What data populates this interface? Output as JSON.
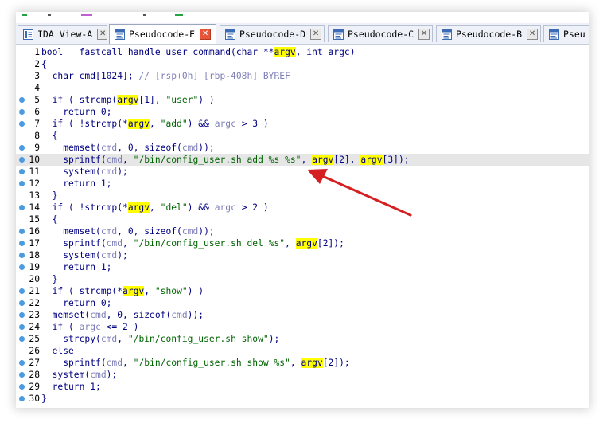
{
  "tabs": [
    {
      "label": "IDA View-A",
      "icon": "ida-view-icon",
      "active": false
    },
    {
      "label": "Pseudocode-E",
      "icon": "pseudocode-icon",
      "active": true
    },
    {
      "label": "Pseudocode-D",
      "icon": "pseudocode-icon",
      "active": false
    },
    {
      "label": "Pseudocode-C",
      "icon": "pseudocode-icon",
      "active": false
    },
    {
      "label": "Pseudocode-B",
      "icon": "pseudocode-icon",
      "active": false
    },
    {
      "label": "Pseu",
      "icon": "pseudocode-icon",
      "active": false
    }
  ],
  "colors": {
    "highlight": "#ffff00",
    "string": "#006400",
    "variable": "#7f7fb8",
    "keyword": "#000080",
    "breakpoint_dot": "#4a9be0",
    "arrow": "#d42020",
    "active_close": "#e8543a"
  },
  "code": {
    "current_line": 10,
    "highlighted_identifier": "argv",
    "lines": [
      {
        "n": "1",
        "dot": false,
        "segs": [
          [
            "t",
            "bool __fastcall handle_user_command(char **"
          ],
          [
            "h",
            "argv"
          ],
          [
            "t",
            ", int argc)"
          ]
        ]
      },
      {
        "n": "2",
        "dot": false,
        "segs": [
          [
            "t",
            "{"
          ]
        ]
      },
      {
        "n": "3",
        "dot": false,
        "segs": [
          [
            "t",
            "  char cmd[1024]; "
          ],
          [
            "c",
            "// [rsp+0h] [rbp-408h] BYREF"
          ]
        ]
      },
      {
        "n": "4",
        "dot": false,
        "segs": []
      },
      {
        "n": "5",
        "dot": true,
        "segs": [
          [
            "t",
            "  if ( strcmp("
          ],
          [
            "h",
            "argv"
          ],
          [
            "t",
            "[1], "
          ],
          [
            "s",
            "\"user\""
          ],
          [
            "t",
            ") )"
          ]
        ]
      },
      {
        "n": "6",
        "dot": true,
        "segs": [
          [
            "t",
            "    return 0;"
          ]
        ]
      },
      {
        "n": "7",
        "dot": true,
        "segs": [
          [
            "t",
            "  if ( !strcmp(*"
          ],
          [
            "h",
            "argv"
          ],
          [
            "t",
            ", "
          ],
          [
            "s",
            "\"add\""
          ],
          [
            "t",
            ") && "
          ],
          [
            "v",
            "argc"
          ],
          [
            "t",
            " > 3 )"
          ]
        ]
      },
      {
        "n": "8",
        "dot": false,
        "segs": [
          [
            "t",
            "  {"
          ]
        ]
      },
      {
        "n": "9",
        "dot": true,
        "segs": [
          [
            "t",
            "    memset("
          ],
          [
            "v",
            "cmd"
          ],
          [
            "t",
            ", 0, sizeof("
          ],
          [
            "v",
            "cmd"
          ],
          [
            "t",
            "));"
          ]
        ]
      },
      {
        "n": "10",
        "dot": true,
        "segs": [
          [
            "t",
            "    sprintf("
          ],
          [
            "v",
            "cmd"
          ],
          [
            "t",
            ", "
          ],
          [
            "s",
            "\"/bin/config_user.sh add %s %s\""
          ],
          [
            "t",
            ", "
          ],
          [
            "h",
            "argv"
          ],
          [
            "t",
            "[2], "
          ],
          [
            "h",
            "argv"
          ],
          [
            "t",
            "[3]);"
          ]
        ]
      },
      {
        "n": "11",
        "dot": true,
        "segs": [
          [
            "t",
            "    system("
          ],
          [
            "v",
            "cmd"
          ],
          [
            "t",
            ");"
          ]
        ]
      },
      {
        "n": "12",
        "dot": true,
        "segs": [
          [
            "t",
            "    return 1;"
          ]
        ]
      },
      {
        "n": "13",
        "dot": false,
        "segs": [
          [
            "t",
            "  }"
          ]
        ]
      },
      {
        "n": "14",
        "dot": true,
        "segs": [
          [
            "t",
            "  if ( !strcmp(*"
          ],
          [
            "h",
            "argv"
          ],
          [
            "t",
            ", "
          ],
          [
            "s",
            "\"del\""
          ],
          [
            "t",
            ") && "
          ],
          [
            "v",
            "argc"
          ],
          [
            "t",
            " > 2 )"
          ]
        ]
      },
      {
        "n": "15",
        "dot": false,
        "segs": [
          [
            "t",
            "  {"
          ]
        ]
      },
      {
        "n": "16",
        "dot": true,
        "segs": [
          [
            "t",
            "    memset("
          ],
          [
            "v",
            "cmd"
          ],
          [
            "t",
            ", 0, sizeof("
          ],
          [
            "v",
            "cmd"
          ],
          [
            "t",
            "));"
          ]
        ]
      },
      {
        "n": "17",
        "dot": true,
        "segs": [
          [
            "t",
            "    sprintf("
          ],
          [
            "v",
            "cmd"
          ],
          [
            "t",
            ", "
          ],
          [
            "s",
            "\"/bin/config_user.sh del %s\""
          ],
          [
            "t",
            ", "
          ],
          [
            "h",
            "argv"
          ],
          [
            "t",
            "[2]);"
          ]
        ]
      },
      {
        "n": "18",
        "dot": true,
        "segs": [
          [
            "t",
            "    system("
          ],
          [
            "v",
            "cmd"
          ],
          [
            "t",
            ");"
          ]
        ]
      },
      {
        "n": "19",
        "dot": true,
        "segs": [
          [
            "t",
            "    return 1;"
          ]
        ]
      },
      {
        "n": "20",
        "dot": false,
        "segs": [
          [
            "t",
            "  }"
          ]
        ]
      },
      {
        "n": "21",
        "dot": true,
        "segs": [
          [
            "t",
            "  if ( strcmp(*"
          ],
          [
            "h",
            "argv"
          ],
          [
            "t",
            ", "
          ],
          [
            "s",
            "\"show\""
          ],
          [
            "t",
            ") )"
          ]
        ]
      },
      {
        "n": "22",
        "dot": true,
        "segs": [
          [
            "t",
            "    return 0;"
          ]
        ]
      },
      {
        "n": "23",
        "dot": true,
        "segs": [
          [
            "t",
            "  memset("
          ],
          [
            "v",
            "cmd"
          ],
          [
            "t",
            ", 0, sizeof("
          ],
          [
            "v",
            "cmd"
          ],
          [
            "t",
            "));"
          ]
        ]
      },
      {
        "n": "24",
        "dot": true,
        "segs": [
          [
            "t",
            "  if ( "
          ],
          [
            "v",
            "argc"
          ],
          [
            "t",
            " <= 2 )"
          ]
        ]
      },
      {
        "n": "25",
        "dot": true,
        "segs": [
          [
            "t",
            "    strcpy("
          ],
          [
            "v",
            "cmd"
          ],
          [
            "t",
            ", "
          ],
          [
            "s",
            "\"/bin/config_user.sh show\""
          ],
          [
            "t",
            ");"
          ]
        ]
      },
      {
        "n": "26",
        "dot": false,
        "segs": [
          [
            "t",
            "  else"
          ]
        ]
      },
      {
        "n": "27",
        "dot": true,
        "segs": [
          [
            "t",
            "    sprintf("
          ],
          [
            "v",
            "cmd"
          ],
          [
            "t",
            ", "
          ],
          [
            "s",
            "\"/bin/config_user.sh show %s\""
          ],
          [
            "t",
            ", "
          ],
          [
            "h",
            "argv"
          ],
          [
            "t",
            "[2]);"
          ]
        ]
      },
      {
        "n": "28",
        "dot": true,
        "segs": [
          [
            "t",
            "  system("
          ],
          [
            "v",
            "cmd"
          ],
          [
            "t",
            ");"
          ]
        ]
      },
      {
        "n": "29",
        "dot": true,
        "segs": [
          [
            "t",
            "  return 1;"
          ]
        ]
      },
      {
        "n": "30",
        "dot": true,
        "segs": [
          [
            "t",
            "}"
          ]
        ]
      }
    ]
  }
}
